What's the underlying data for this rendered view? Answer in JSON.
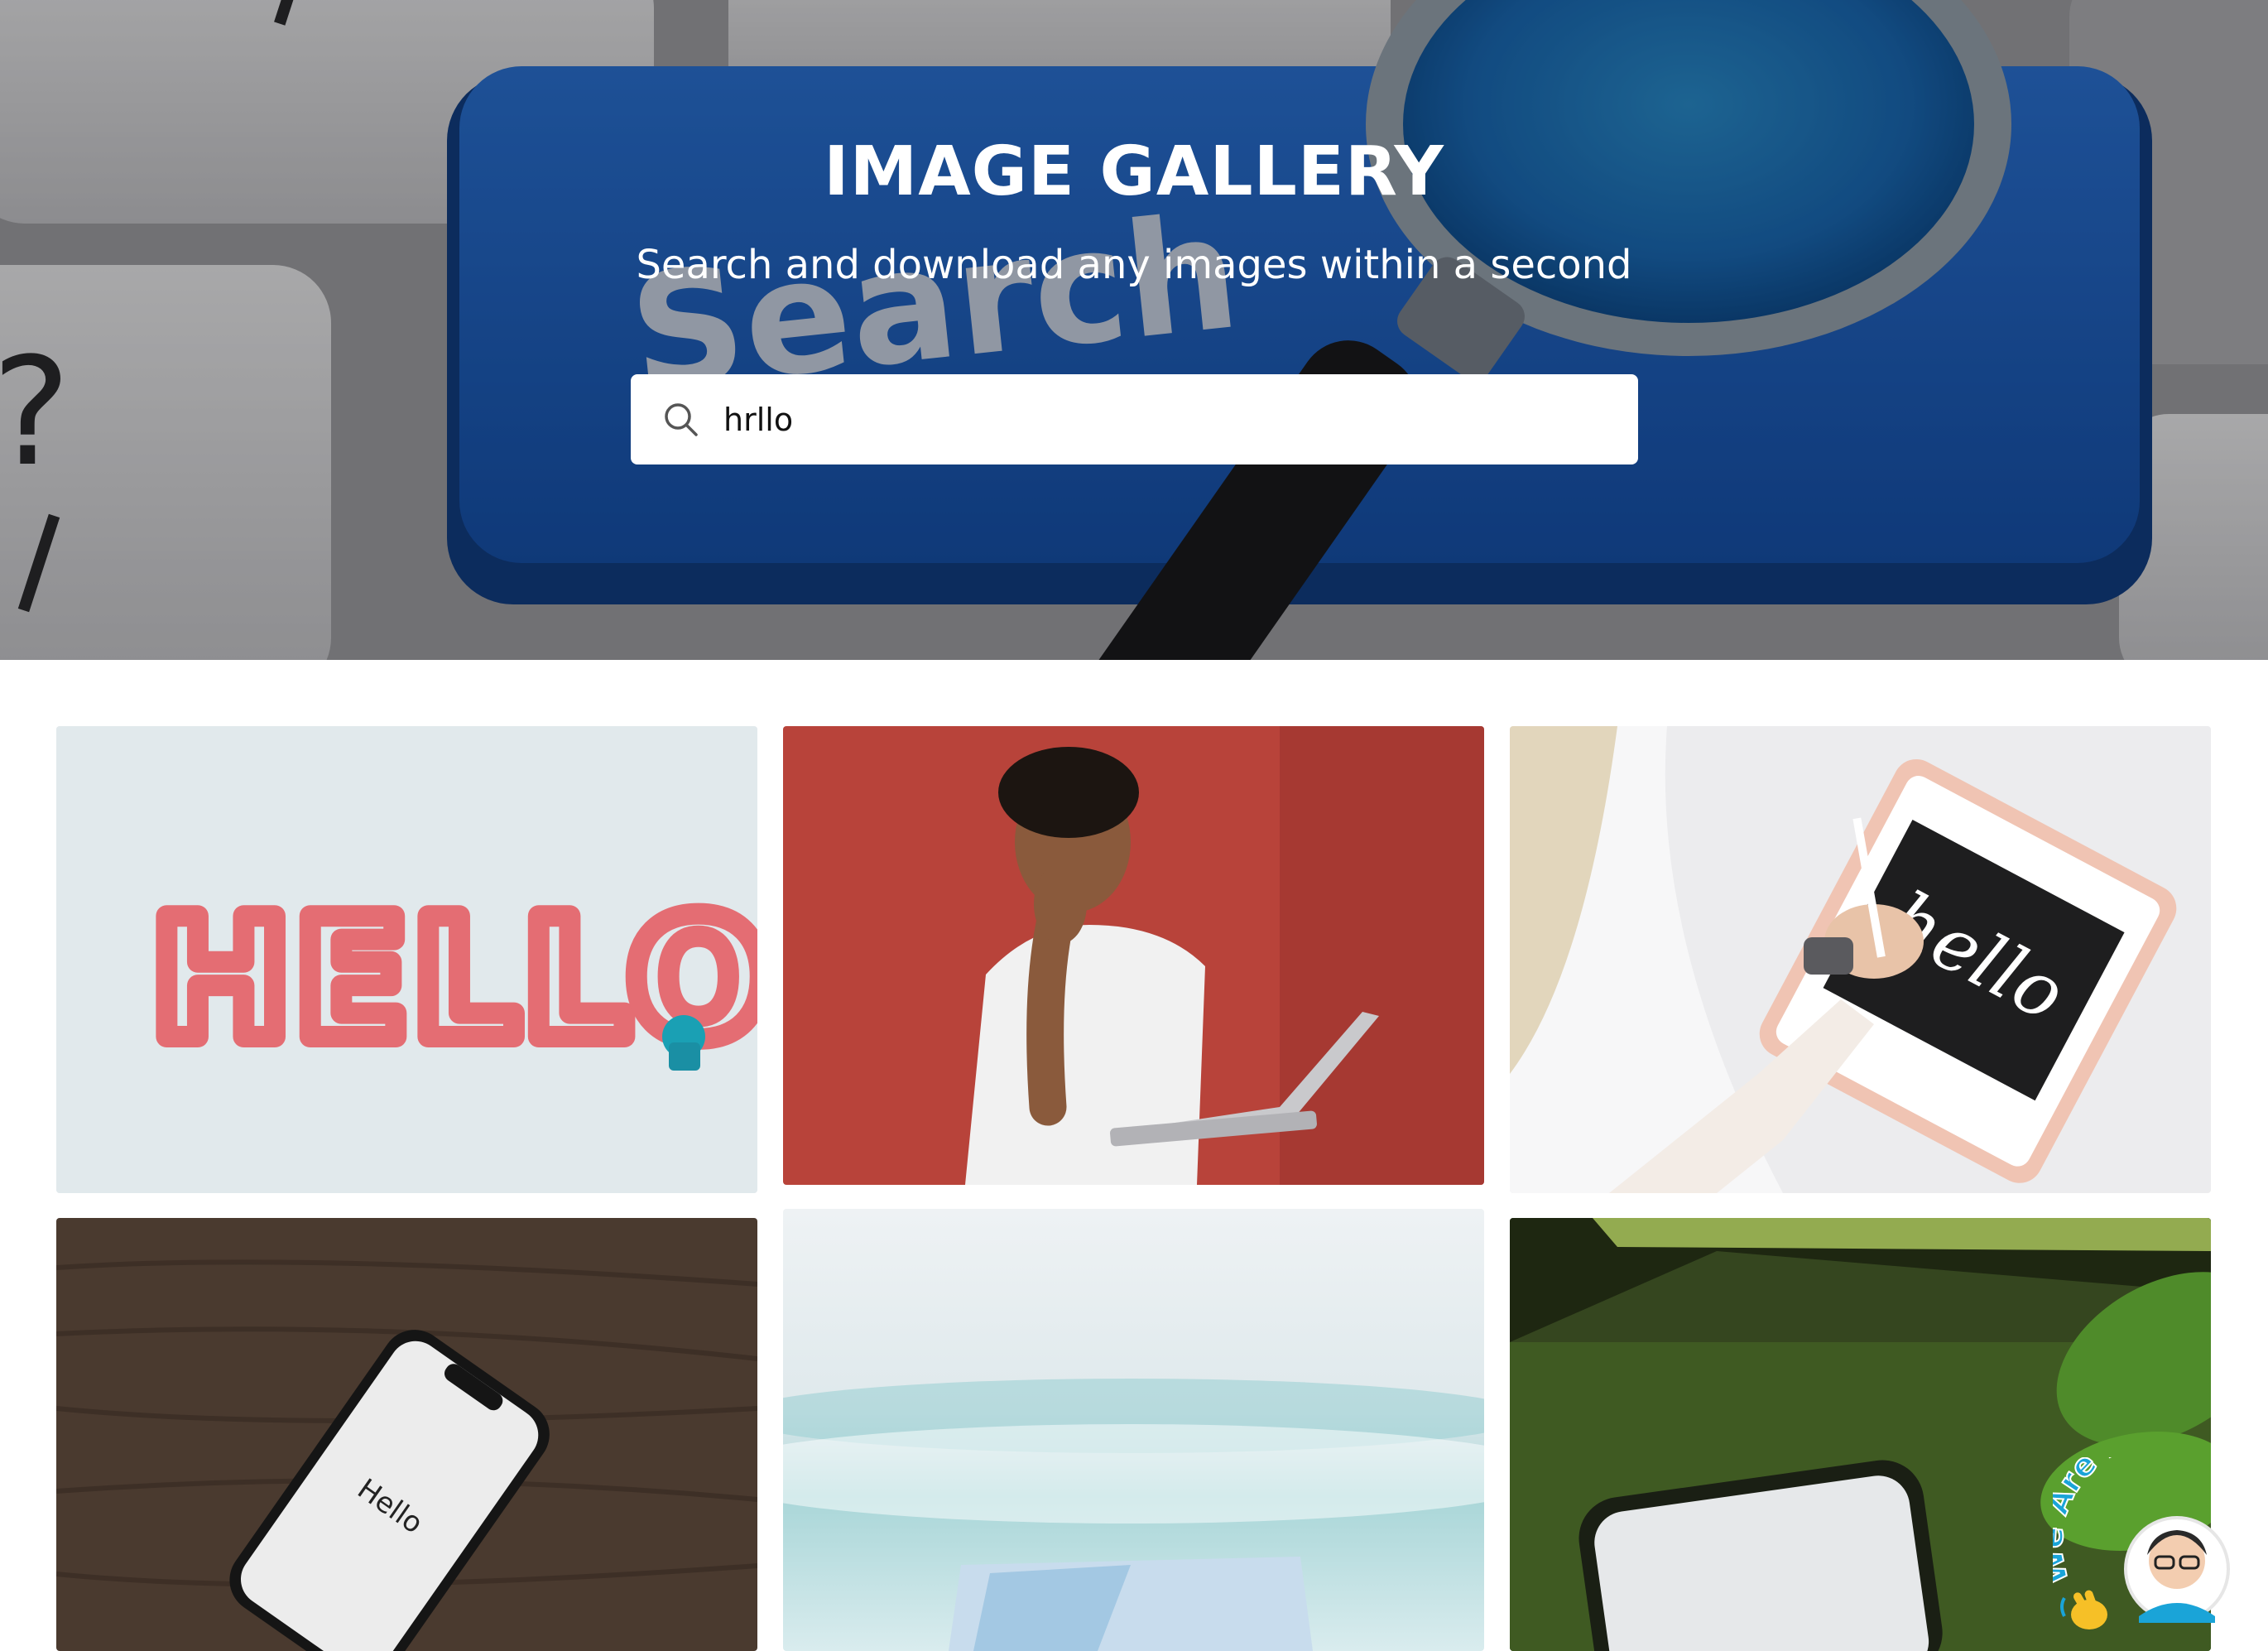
{
  "hero": {
    "title": "IMAGE GALLERY",
    "subtitle": "Search and download any images within a second",
    "background_key_text": "Search"
  },
  "search": {
    "value": "hrllo",
    "icon": "search-icon"
  },
  "gallery": {
    "images": [
      {
        "id": "image-hello-clay-letters",
        "text": "HELLO"
      },
      {
        "id": "image-man-waving-laptop",
        "text": ""
      },
      {
        "id": "image-tablet-hello-lettering",
        "text": "hello"
      },
      {
        "id": "image-phone-hello-wood",
        "text": "Hello"
      },
      {
        "id": "image-beach-card",
        "text": ""
      },
      {
        "id": "image-phone-plant",
        "text": ""
      }
    ]
  },
  "chat_widget": {
    "label": "We Are Here!",
    "icon": "waving-hand-icon"
  },
  "colors": {
    "hero_key_blue": "#1f63c6",
    "search_box_bg": "#ffffff",
    "title_text": "#ffffff",
    "widget_accent": "#1aa4d8"
  }
}
